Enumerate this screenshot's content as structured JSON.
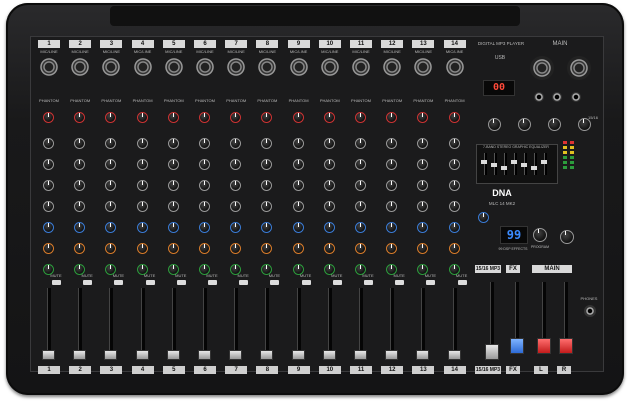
{
  "channels": [
    {
      "num": "1",
      "label": "MIC/LINE"
    },
    {
      "num": "2",
      "label": "MIC/LINE"
    },
    {
      "num": "3",
      "label": "MIC/LINE"
    },
    {
      "num": "4",
      "label": "MIC/LINE"
    },
    {
      "num": "5",
      "label": "MIC/LINE"
    },
    {
      "num": "6",
      "label": "MIC/LINE"
    },
    {
      "num": "7",
      "label": "MIC/LINE"
    },
    {
      "num": "8",
      "label": "MIC/LINE"
    },
    {
      "num": "9",
      "label": "MIC/LINE"
    },
    {
      "num": "10",
      "label": "MIC/LINE"
    },
    {
      "num": "11",
      "label": "MIC/LINE"
    },
    {
      "num": "12",
      "label": "MIC/LINE"
    },
    {
      "num": "13",
      "label": "MIC/LINE"
    },
    {
      "num": "14",
      "label": "MIC/LINE"
    }
  ],
  "phantom_label": "PHANTOM",
  "mute_label": "MUTE",
  "digital_player_label": "DIGITAL MP3 PLAYER",
  "usb_label": "USB",
  "player_display": "00",
  "main_label": "MAIN",
  "eq_label": "7-BAND STEREO GRAPHIC EQUALIZER",
  "brand": "DNA",
  "model": "MLC 14 MK2",
  "fx_display": "99",
  "program_label": "PROGRAM",
  "effects_label": "99 DSP EFFECTS",
  "phones_label": "PHONES",
  "st_label": "15/16",
  "strip_labels": {
    "st": "15/16 MP3",
    "fx": "FX",
    "l": "L",
    "main": "MAIN",
    "r": "R"
  },
  "led_colors": {
    "accent": "#3b8bff",
    "red": "#c31b1b",
    "blue": "#2d6bd6"
  }
}
